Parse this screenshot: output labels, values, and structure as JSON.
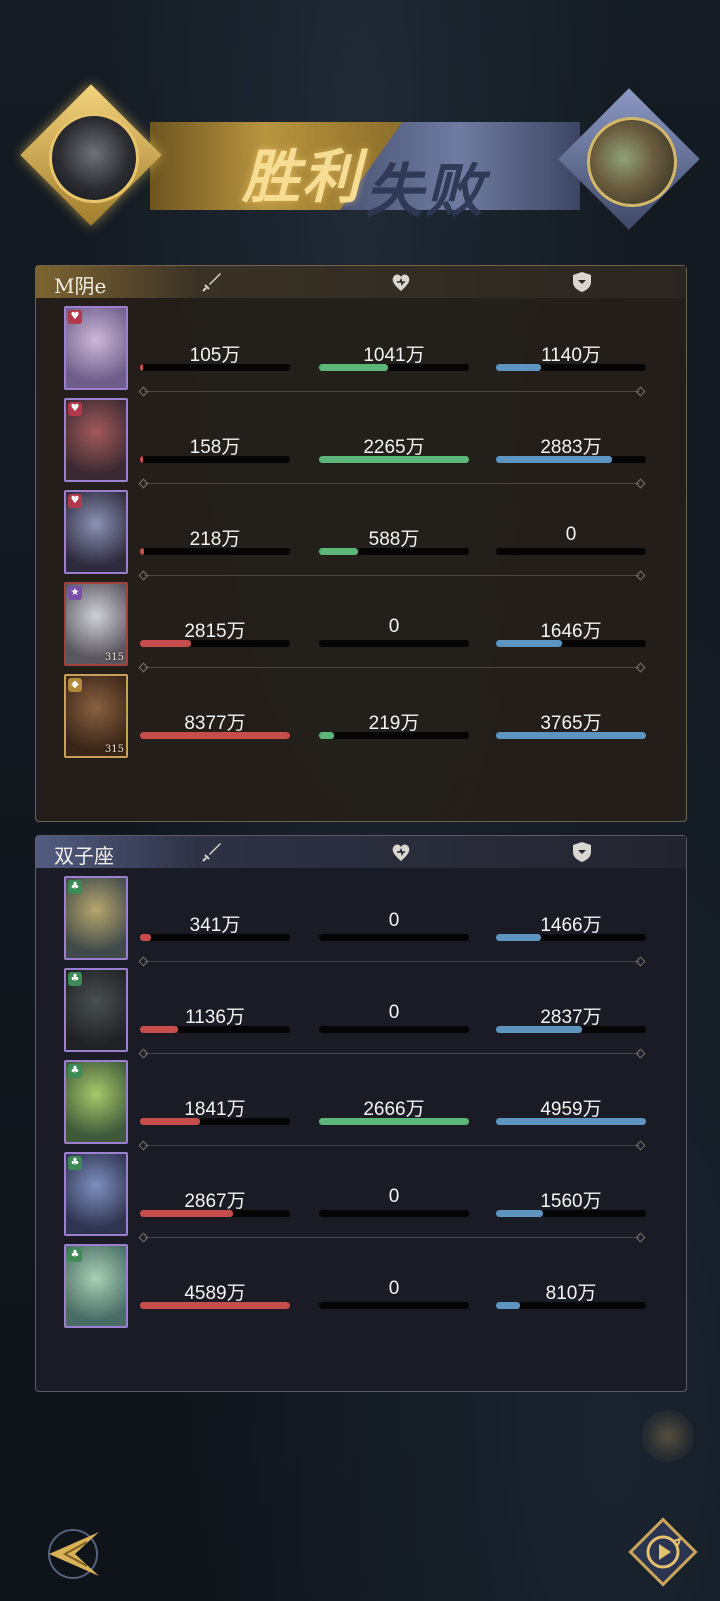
{
  "banner": {
    "win_text": "胜利",
    "lose_text": "失败"
  },
  "colors": {
    "attack": "#c74d4a",
    "heal": "#5cb67a",
    "defense": "#5e95c0",
    "gold": "#e8c46a"
  },
  "icons": {
    "attack": "sword-icon",
    "heal": "heart-icon",
    "defense": "shield-icon",
    "back": "back-arrow-icon",
    "replay": "replay-icon"
  },
  "teams": [
    {
      "name": "M阴e",
      "heroes": [
        {
          "badge": "heart",
          "level": "",
          "damage": "105万",
          "damage_ratio": 0.013,
          "heal": "1041万",
          "heal_ratio": 0.46,
          "defense": "1140万",
          "defense_ratio": 0.3
        },
        {
          "badge": "heart",
          "level": "",
          "damage": "158万",
          "damage_ratio": 0.019,
          "heal": "2265万",
          "heal_ratio": 1.0,
          "defense": "2883万",
          "defense_ratio": 0.77
        },
        {
          "badge": "heart",
          "level": "",
          "damage": "218万",
          "damage_ratio": 0.026,
          "heal": "588万",
          "heal_ratio": 0.26,
          "defense": "0",
          "defense_ratio": 0
        },
        {
          "badge": "star",
          "level": "315",
          "damage": "2815万",
          "damage_ratio": 0.34,
          "heal": "0",
          "heal_ratio": 0,
          "defense": "1646万",
          "defense_ratio": 0.44
        },
        {
          "badge": "diamond",
          "level": "315",
          "damage": "8377万",
          "damage_ratio": 1.0,
          "heal": "219万",
          "heal_ratio": 0.1,
          "defense": "3765万",
          "defense_ratio": 1.0
        }
      ]
    },
    {
      "name": "双子座",
      "heroes": [
        {
          "badge": "clover",
          "level": "",
          "damage": "341万",
          "damage_ratio": 0.074,
          "heal": "0",
          "heal_ratio": 0,
          "defense": "1466万",
          "defense_ratio": 0.3
        },
        {
          "badge": "clover",
          "level": "",
          "damage": "1136万",
          "damage_ratio": 0.25,
          "heal": "0",
          "heal_ratio": 0,
          "defense": "2837万",
          "defense_ratio": 0.57
        },
        {
          "badge": "clover",
          "level": "",
          "damage": "1841万",
          "damage_ratio": 0.4,
          "heal": "2666万",
          "heal_ratio": 1.0,
          "defense": "4959万",
          "defense_ratio": 1.0
        },
        {
          "badge": "clover",
          "level": "",
          "damage": "2867万",
          "damage_ratio": 0.62,
          "heal": "0",
          "heal_ratio": 0,
          "defense": "1560万",
          "defense_ratio": 0.31
        },
        {
          "badge": "clover",
          "level": "",
          "damage": "4589万",
          "damage_ratio": 1.0,
          "heal": "0",
          "heal_ratio": 0,
          "defense": "810万",
          "defense_ratio": 0.16
        }
      ]
    }
  ]
}
